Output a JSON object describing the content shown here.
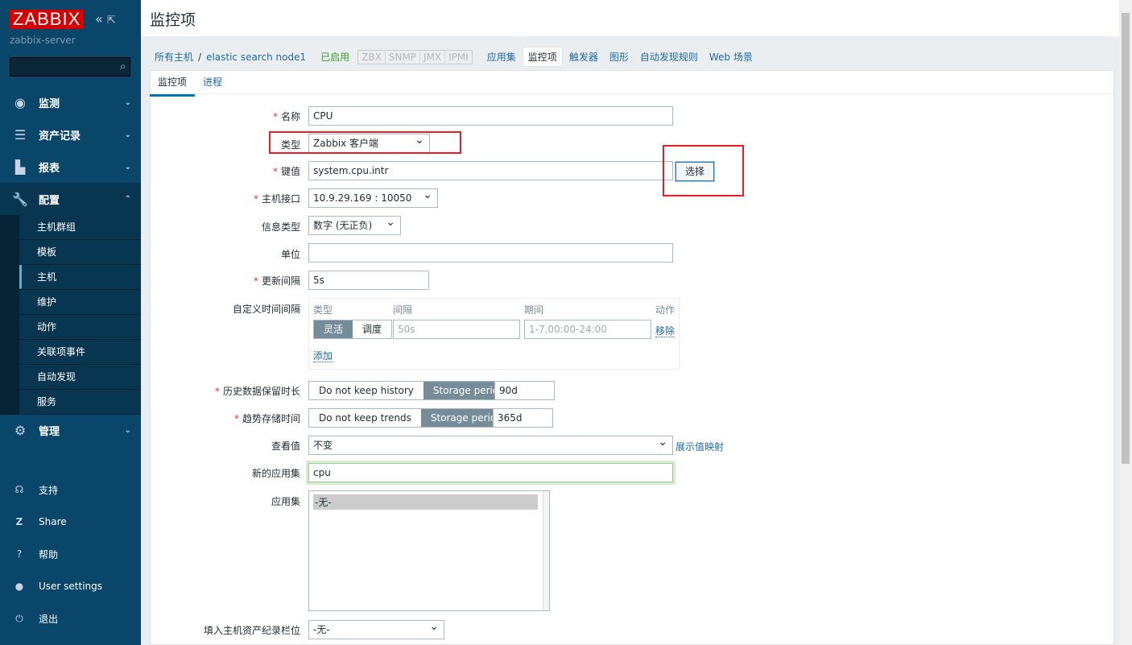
{
  "sidebar": {
    "logo": "ZABBIX",
    "server": "zabbix-server",
    "search_placeholder": "",
    "menu": [
      {
        "label": "监测",
        "icon": "eye-icon"
      },
      {
        "label": "资产记录",
        "icon": "list-icon"
      },
      {
        "label": "报表",
        "icon": "bar-chart-icon"
      },
      {
        "label": "配置",
        "icon": "wrench-icon"
      },
      {
        "label": "管理",
        "icon": "gear-icon"
      }
    ],
    "submenu": [
      "主机群组",
      "模板",
      "主机",
      "维护",
      "动作",
      "关联项事件",
      "自动发现",
      "服务"
    ],
    "active_sub": "主机",
    "bottom": [
      {
        "label": "支持",
        "icon": "headset-icon"
      },
      {
        "label": "Share",
        "icon": "share-icon"
      },
      {
        "label": "帮助",
        "icon": "help-icon"
      },
      {
        "label": "User settings",
        "icon": "user-icon"
      },
      {
        "label": "退出",
        "icon": "power-icon"
      }
    ]
  },
  "page": {
    "title": "监控项"
  },
  "nav": {
    "all_hosts": "所有主机",
    "sep": "/",
    "host": "elastic search node1",
    "status": "已启用",
    "tags": [
      "ZBX",
      "SNMP",
      "JMX",
      "IPMI"
    ],
    "links": [
      "应用集",
      "监控项",
      "触发器",
      "图形",
      "自动发现规则",
      "Web 场景"
    ],
    "current": "监控项"
  },
  "tabs": [
    "监控项",
    "进程"
  ],
  "form": {
    "name": {
      "label": "名称",
      "value": "CPU"
    },
    "type": {
      "label": "类型",
      "value": "Zabbix 客户端"
    },
    "key": {
      "label": "键值",
      "value": "system.cpu.intr",
      "button": "选择"
    },
    "interface": {
      "label": "主机接口",
      "value": "10.9.29.169 : 10050"
    },
    "info_type": {
      "label": "信息类型",
      "value": "数字 (无正负)"
    },
    "units": {
      "label": "单位",
      "value": ""
    },
    "interval": {
      "label": "更新间隔",
      "value": "5s"
    },
    "custom": {
      "label": "自定义时间间隔",
      "headers": [
        "类型",
        "间隔",
        "期间",
        "动作"
      ],
      "modes": [
        "灵活",
        "调度"
      ],
      "interval_placeholder": "50s",
      "period_placeholder": "1-7,00:00-24:00",
      "remove": "移除",
      "add": "添加"
    },
    "history": {
      "label": "历史数据保留时长",
      "options": [
        "Do not keep history",
        "Storage period"
      ],
      "value": "90d"
    },
    "trends": {
      "label": "趋势存储时间",
      "options": [
        "Do not keep trends",
        "Storage period"
      ],
      "value": "365d"
    },
    "valuemap": {
      "label": "查看值",
      "value": "不变",
      "link": "展示值映射"
    },
    "new_app": {
      "label": "新的应用集",
      "value": "cpu"
    },
    "apps": {
      "label": "应用集",
      "items": [
        "-无-"
      ]
    },
    "inventory": {
      "label": "填入主机资产纪录栏位",
      "value": "-无-"
    }
  },
  "colors": {
    "sidebar": "#0a466a",
    "accent": "#0275b8",
    "highlight": "#ed1c24"
  }
}
